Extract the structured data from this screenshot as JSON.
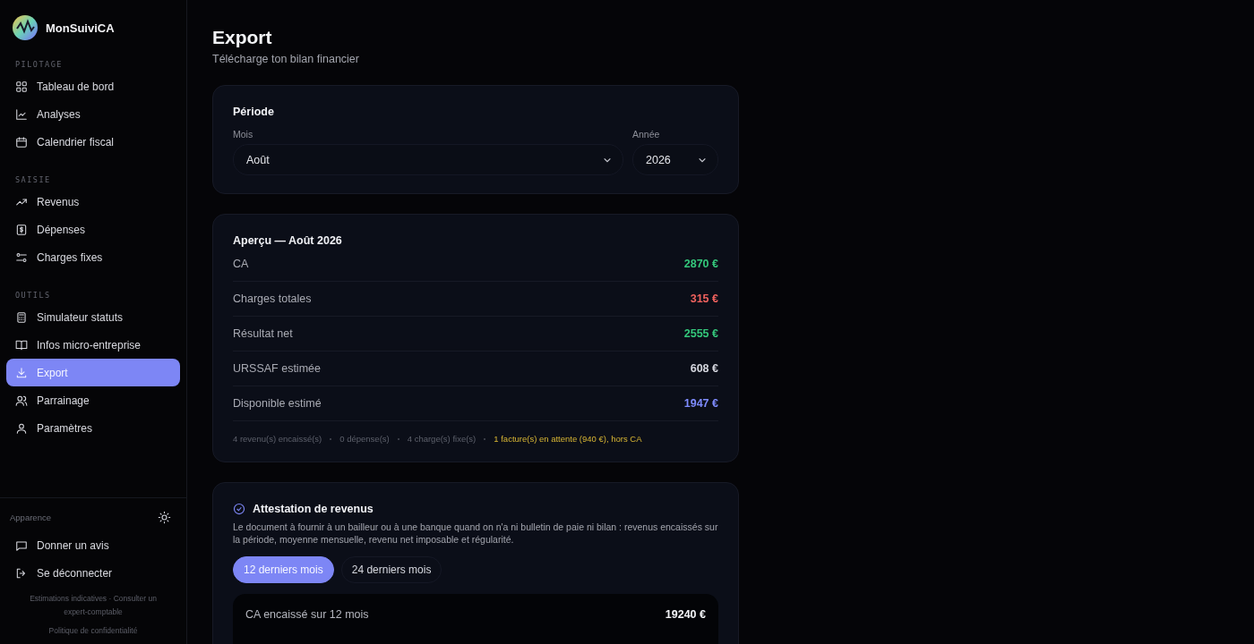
{
  "app": {
    "name": "MonSuiviCA"
  },
  "sidebar": {
    "sections": [
      {
        "label": "PILOTAGE",
        "items": [
          {
            "label": "Tableau de bord",
            "selected": false
          },
          {
            "label": "Analyses",
            "selected": false
          },
          {
            "label": "Calendrier fiscal",
            "selected": false
          }
        ]
      },
      {
        "label": "SAISIE",
        "items": [
          {
            "label": "Revenus",
            "selected": false
          },
          {
            "label": "Dépenses",
            "selected": false
          },
          {
            "label": "Charges fixes",
            "selected": false
          }
        ]
      },
      {
        "label": "OUTILS",
        "items": [
          {
            "label": "Simulateur statuts",
            "selected": false
          },
          {
            "label": "Infos micro-entreprise",
            "selected": false
          },
          {
            "label": "Export",
            "selected": true
          },
          {
            "label": "Parrainage",
            "selected": false
          },
          {
            "label": "Paramètres",
            "selected": false
          }
        ]
      }
    ],
    "appearance_label": "Apparence",
    "bottom_items": [
      {
        "label": "Donner un avis"
      },
      {
        "label": "Se déconnecter"
      }
    ],
    "disclaimer": "Estimations indicatives · Consulter un expert-comptable",
    "privacy_link": "Politique de confidentialité"
  },
  "page": {
    "title": "Export",
    "subtitle": "Télécharge ton bilan financier"
  },
  "period": {
    "title": "Période",
    "month": {
      "label": "Mois",
      "value": "Août"
    },
    "year": {
      "label": "Année",
      "value": "2026"
    }
  },
  "overview": {
    "title": "Aperçu — Août 2026",
    "rows": [
      {
        "label": "CA",
        "value": "2870 €",
        "color": "#34c77b"
      },
      {
        "label": "Charges totales",
        "value": "315 €",
        "color": "#f0625e"
      },
      {
        "label": "Résultat net",
        "value": "2555 €",
        "color": "#34c77b"
      },
      {
        "label": "URSSAF estimée",
        "value": "608 €",
        "color": "#d4d6de"
      },
      {
        "label": "Disponible estimé",
        "value": "1947 €",
        "color": "#7f8cff"
      }
    ],
    "summary": [
      "4 revenu(s) encaissé(s)",
      "0 dépense(s)",
      "4 charge(s) fixe(s)"
    ],
    "pending_note": "1 facture(s) en attente (940 €), hors CA"
  },
  "attestation": {
    "title": "Attestation de revenus",
    "description": "Le document à fournir à un bailleur ou à une banque quand on n'a ni bulletin de paie ni bilan : revenus encaissés sur la période, moyenne mensuelle, revenu net imposable et régularité.",
    "tabs": [
      {
        "label": "12 derniers mois",
        "selected": true
      },
      {
        "label": "24 derniers mois",
        "selected": false
      }
    ],
    "rows": [
      {
        "label": "CA encaissé sur 12 mois",
        "value": "19240 €"
      }
    ]
  }
}
